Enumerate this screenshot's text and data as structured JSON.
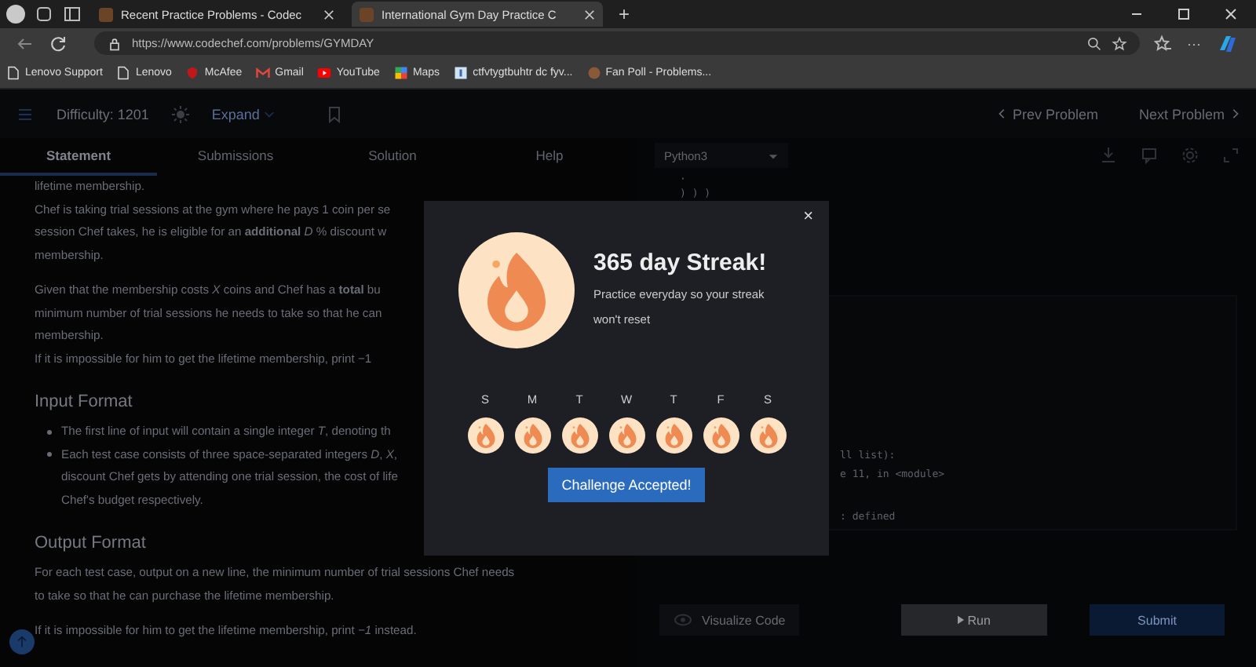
{
  "browser": {
    "tabs": [
      {
        "title": "Recent Practice Problems - Codec",
        "selected": false
      },
      {
        "title": "International Gym Day Practice C",
        "selected": true
      }
    ],
    "new_tab": "+",
    "url": "https://www.codechef.com/problems/GYMDAY",
    "more": "···",
    "bookmarks": [
      {
        "label": "Lenovo Support",
        "kind": "page"
      },
      {
        "label": "Lenovo",
        "kind": "page"
      },
      {
        "label": "McAfee",
        "kind": "shield"
      },
      {
        "label": "Gmail",
        "kind": "mail"
      },
      {
        "label": "YouTube",
        "kind": "play"
      },
      {
        "label": "Maps",
        "kind": "map"
      },
      {
        "label": "ctfvtygtbuhtr dc fyv...",
        "kind": "t"
      },
      {
        "label": "Fan Poll - Problems...",
        "kind": "cc"
      }
    ]
  },
  "header": {
    "difficulty": "Difficulty: 1201",
    "expand": "Expand",
    "prev": "Prev Problem",
    "next": "Next Problem"
  },
  "tabs": [
    {
      "label": "Statement",
      "selected": true
    },
    {
      "label": "Submissions",
      "selected": false
    },
    {
      "label": "Solution",
      "selected": false
    },
    {
      "label": "Help",
      "selected": false
    }
  ],
  "statement": [
    {
      "kind": "line",
      "text": "lifetime membership."
    },
    {
      "kind": "line",
      "text": "Chef is taking trial sessions at the gym where he pays 1 coin per se"
    },
    {
      "kind": "line",
      "text": "session Chef takes, he is eligible for an **additional** *D* % discount w"
    },
    {
      "kind": "end",
      "text": "membership."
    },
    {
      "kind": "line",
      "text": "Given that the membership costs *X* coins and Chef has a **total** bu"
    },
    {
      "kind": "line",
      "text": "minimum number of trial sessions he needs to take so that he can"
    },
    {
      "kind": "line",
      "text": "membership."
    },
    {
      "kind": "line",
      "text": "If it is impossible for him to get the lifetime membership, print −1"
    },
    {
      "kind": "heading",
      "text": "Input Format"
    },
    {
      "kind": "bullet",
      "text": "The first line of input will contain a single integer *T*, denoting th"
    },
    {
      "kind": "bullet",
      "text": "Each test case consists of three space-separated integers *D*, *X*,"
    },
    {
      "kind": "indent",
      "text": "discount Chef gets by attending one trial session, the cost of life"
    },
    {
      "kind": "indent",
      "text": "Chef's budget respectively."
    },
    {
      "kind": "heading",
      "text": "Output Format"
    },
    {
      "kind": "line",
      "text": "For each test case, output on a new line, the minimum number of trial sessions Chef needs"
    },
    {
      "kind": "end",
      "text": "to take so that he can purchase the lifetime membership."
    },
    {
      "kind": "line",
      "text": "If it is impossible for him to get the lifetime membership, print *−1* instead."
    }
  ],
  "editor": {
    "language": "Python3",
    "code": [
      "·",
      ") ) )"
    ],
    "output": [
      "ll list):",
      "e 11, in <module>",
      ": defined"
    ],
    "visualize": "Visualize Code",
    "run": "Run",
    "submit": "Submit"
  },
  "modal": {
    "close": "×",
    "title": "365 day Streak!",
    "message": "Practice everyday so your streak won't reset",
    "days": [
      "S",
      "M",
      "T",
      "W",
      "T",
      "F",
      "S"
    ],
    "button": "Challenge Accepted!"
  }
}
